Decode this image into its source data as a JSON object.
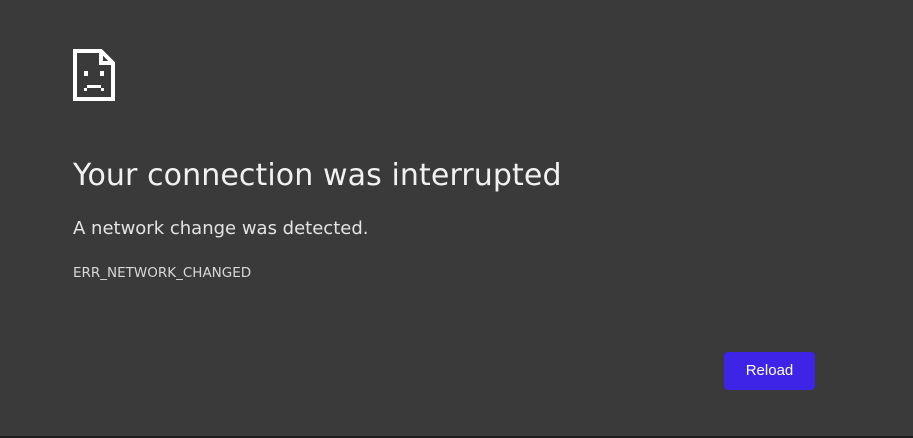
{
  "error_page": {
    "icon": "sad-page-icon",
    "title": "Your connection was interrupted",
    "message": "A network change was detected.",
    "error_code": "ERR_NETWORK_CHANGED",
    "reload_label": "Reload"
  },
  "colors": {
    "background": "#3a3a3a",
    "text": "#f1f1f1",
    "accent": "#3d24e6"
  }
}
